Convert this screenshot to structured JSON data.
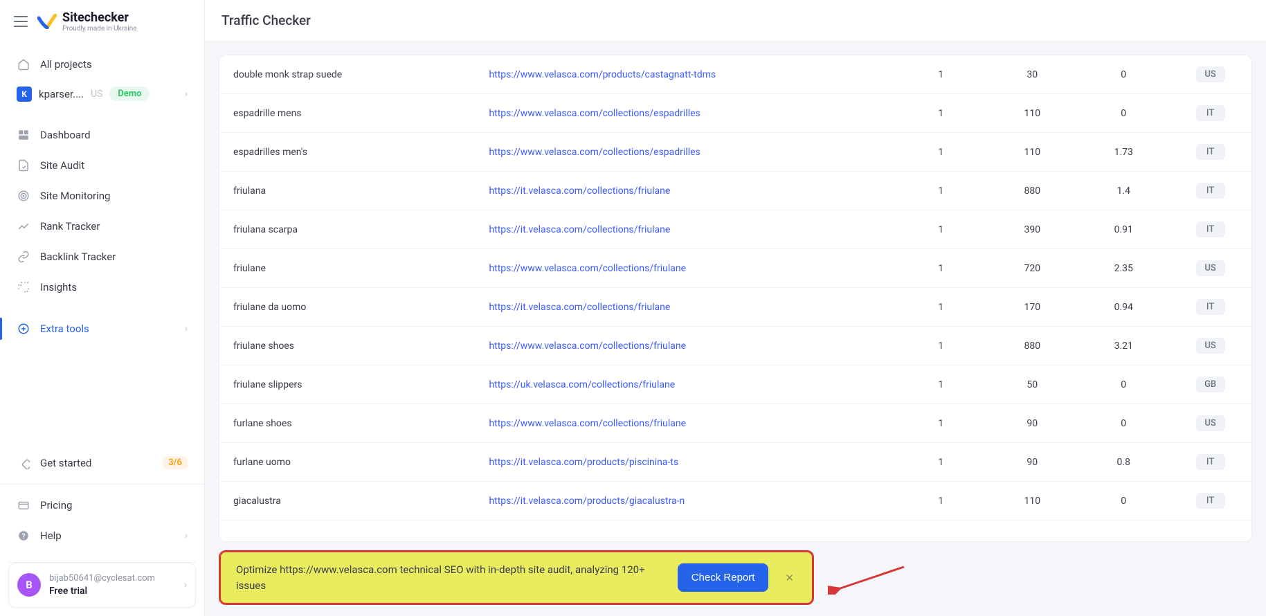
{
  "header": {
    "brand_title": "Sitechecker",
    "brand_subtitle": "Proudly made in Ukraine",
    "page_title": "Traffic Checker"
  },
  "sidebar": {
    "all_projects": "All projects",
    "project": {
      "badge": "K",
      "name": "kparser....",
      "region": "US",
      "demo": "Demo"
    },
    "items": [
      {
        "label": "Dashboard"
      },
      {
        "label": "Site Audit"
      },
      {
        "label": "Site Monitoring"
      },
      {
        "label": "Rank Tracker"
      },
      {
        "label": "Backlink Tracker"
      },
      {
        "label": "Insights"
      },
      {
        "label": "Extra tools"
      }
    ],
    "get_started": {
      "label": "Get started",
      "badge": "3/6"
    },
    "pricing": "Pricing",
    "help": "Help"
  },
  "user": {
    "avatar_letter": "B",
    "email": "bijab50641@cyclesat.com",
    "plan": "Free trial"
  },
  "table": {
    "rows": [
      {
        "keyword": "double monk strap suede",
        "url": "https://www.velasca.com/products/castagnatt-tdms",
        "pos": "1",
        "vol": "30",
        "val3": "0",
        "country": "US"
      },
      {
        "keyword": "espadrille mens",
        "url": "https://www.velasca.com/collections/espadrilles",
        "pos": "1",
        "vol": "110",
        "val3": "0",
        "country": "IT"
      },
      {
        "keyword": "espadrilles men's",
        "url": "https://www.velasca.com/collections/espadrilles",
        "pos": "1",
        "vol": "110",
        "val3": "1.73",
        "country": "IT"
      },
      {
        "keyword": "friulana",
        "url": "https://it.velasca.com/collections/friulane",
        "pos": "1",
        "vol": "880",
        "val3": "1.4",
        "country": "IT"
      },
      {
        "keyword": "friulana scarpa",
        "url": "https://it.velasca.com/collections/friulane",
        "pos": "1",
        "vol": "390",
        "val3": "0.91",
        "country": "IT"
      },
      {
        "keyword": "friulane",
        "url": "https://www.velasca.com/collections/friulane",
        "pos": "1",
        "vol": "720",
        "val3": "2.35",
        "country": "US"
      },
      {
        "keyword": "friulane da uomo",
        "url": "https://it.velasca.com/collections/friulane",
        "pos": "1",
        "vol": "170",
        "val3": "0.94",
        "country": "IT"
      },
      {
        "keyword": "friulane shoes",
        "url": "https://www.velasca.com/collections/friulane",
        "pos": "1",
        "vol": "880",
        "val3": "3.21",
        "country": "US"
      },
      {
        "keyword": "friulane slippers",
        "url": "https://uk.velasca.com/collections/friulane",
        "pos": "1",
        "vol": "50",
        "val3": "0",
        "country": "GB"
      },
      {
        "keyword": "furlane shoes",
        "url": "https://www.velasca.com/collections/friulane",
        "pos": "1",
        "vol": "90",
        "val3": "0",
        "country": "US"
      },
      {
        "keyword": "furlane uomo",
        "url": "https://it.velasca.com/products/piscinina-ts",
        "pos": "1",
        "vol": "90",
        "val3": "0.8",
        "country": "IT"
      },
      {
        "keyword": "giacalustra",
        "url": "https://it.velasca.com/products/giacalustra-n",
        "pos": "1",
        "vol": "110",
        "val3": "0",
        "country": "IT"
      }
    ]
  },
  "banner": {
    "text": "Optimize https://www.velasca.com technical SEO with in-depth site audit, analyzing 120+ issues",
    "button": "Check Report"
  }
}
